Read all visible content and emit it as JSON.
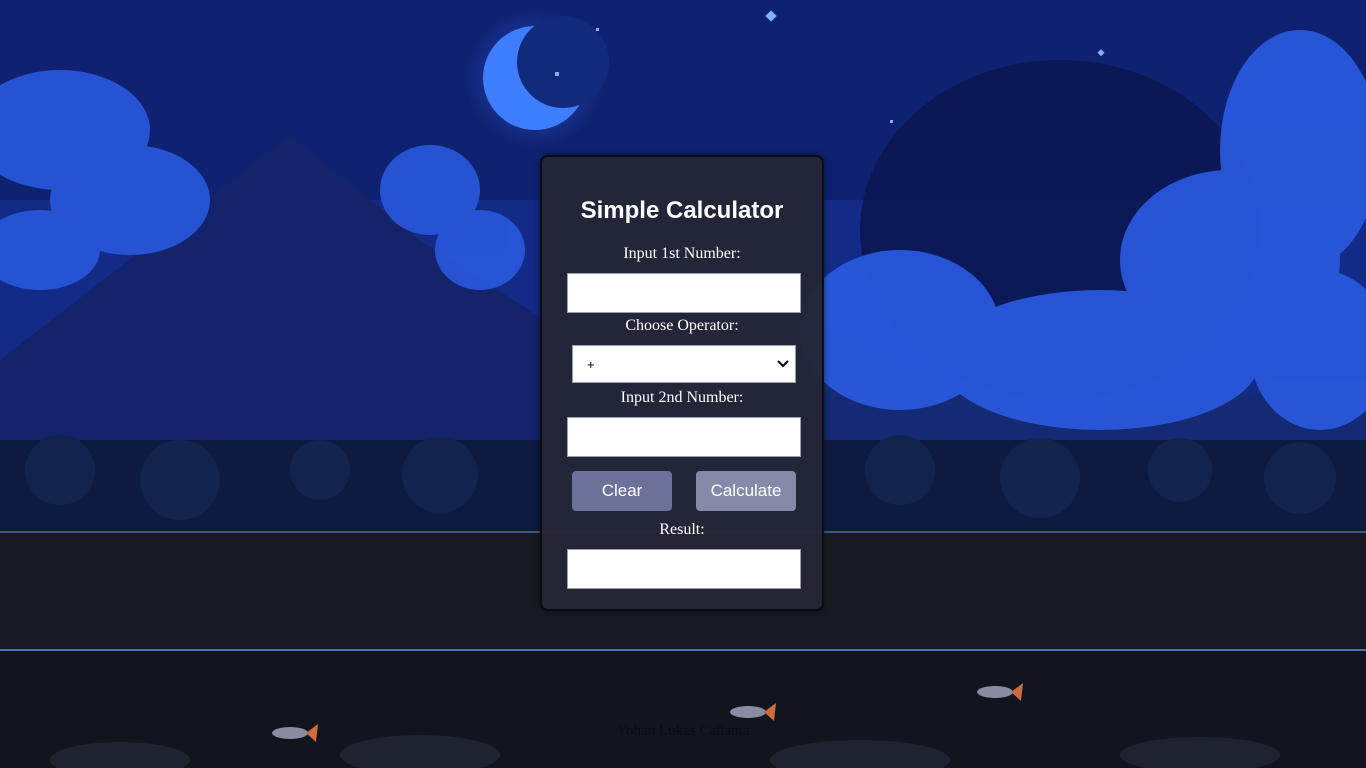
{
  "calculator": {
    "title": "Simple Calculator",
    "first_label": "Input 1st Number:",
    "first_value": "",
    "operator_label": "Choose Operator:",
    "operator_selected": "+",
    "second_label": "Input 2nd Number:",
    "second_value": "",
    "clear_label": "Clear",
    "calculate_label": "Calculate",
    "result_label": "Result:",
    "result_value": ""
  },
  "footer": {
    "author": "Yohan Lukas Callanta"
  },
  "background": {
    "scene": "pixel-art night landscape",
    "icons": [
      "moon-icon",
      "star-icon",
      "fish-icon"
    ],
    "sky_color": "#1a3a9a",
    "card_color": "#242636",
    "clear_button_color": "#6b7199",
    "calculate_button_color": "#858aa8"
  }
}
